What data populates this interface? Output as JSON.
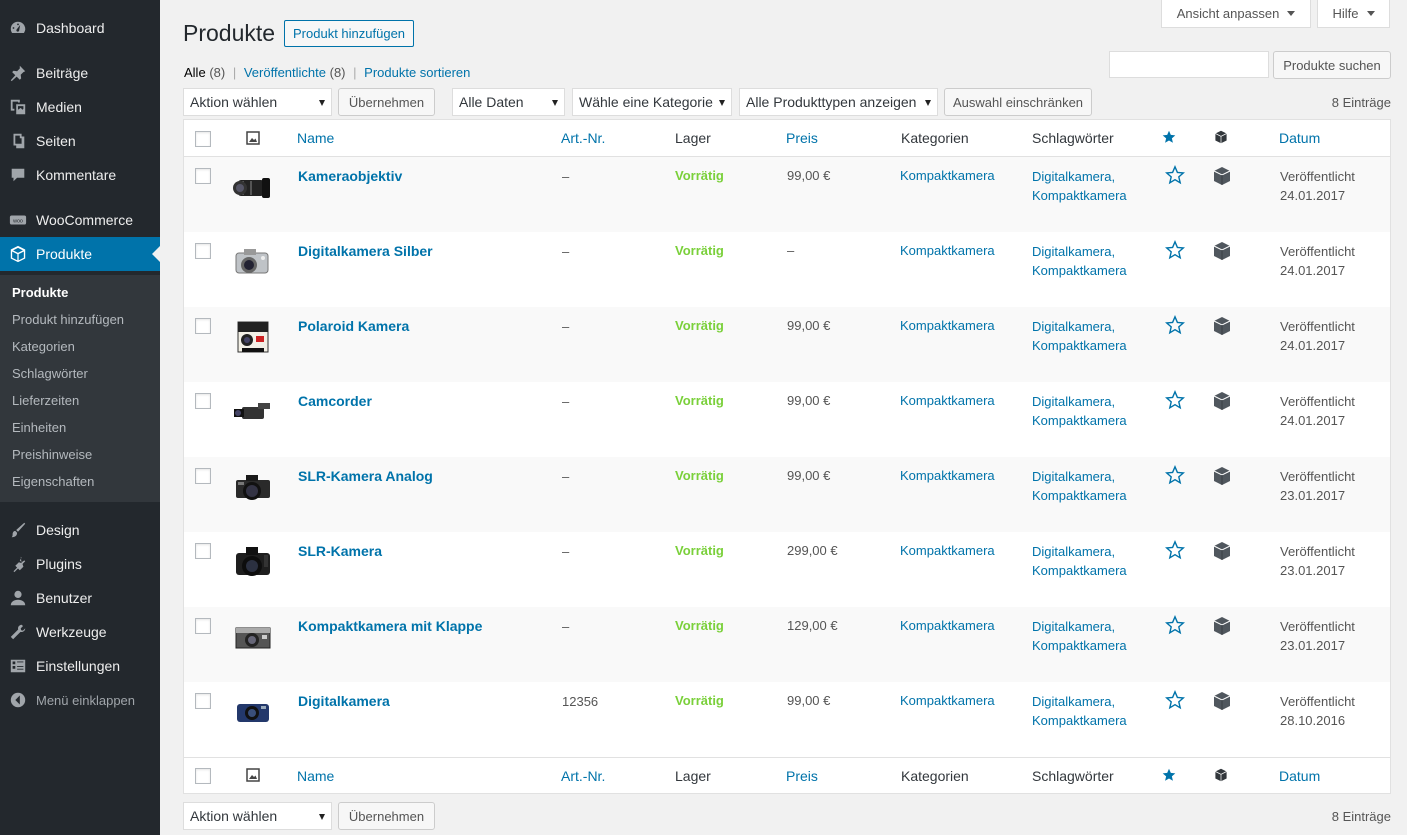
{
  "sidebar": {
    "items": [
      {
        "label": "Dashboard",
        "icon": "dashboard-icon"
      },
      {
        "label": "Beiträge",
        "icon": "pin-icon"
      },
      {
        "label": "Medien",
        "icon": "media-icon"
      },
      {
        "label": "Seiten",
        "icon": "pages-icon"
      },
      {
        "label": "Kommentare",
        "icon": "comments-icon"
      },
      {
        "label": "WooCommerce",
        "icon": "woocommerce-icon"
      },
      {
        "label": "Produkte",
        "icon": "box-icon"
      },
      {
        "label": "Design",
        "icon": "brush-icon"
      },
      {
        "label": "Plugins",
        "icon": "plugin-icon"
      },
      {
        "label": "Benutzer",
        "icon": "user-icon"
      },
      {
        "label": "Werkzeuge",
        "icon": "wrench-icon"
      },
      {
        "label": "Einstellungen",
        "icon": "settings-icon"
      },
      {
        "label": "Menü einklappen",
        "icon": "collapse-icon"
      }
    ],
    "submenu": [
      "Produkte",
      "Produkt hinzufügen",
      "Kategorien",
      "Schlagwörter",
      "Lieferzeiten",
      "Einheiten",
      "Preishinweise",
      "Eigenschaften"
    ]
  },
  "header": {
    "screen_options": "Ansicht anpassen",
    "help": "Hilfe",
    "title": "Produkte",
    "add_new": "Produkt hinzufügen"
  },
  "views": {
    "all": "Alle",
    "all_count": "(8)",
    "published": "Veröffentlichte",
    "published_count": "(8)",
    "sort": "Produkte sortieren",
    "separator": "|"
  },
  "search": {
    "button": "Produkte suchen",
    "value": ""
  },
  "filters": {
    "bulk_action": "Aktion wählen",
    "apply": "Übernehmen",
    "dates": "Alle Daten",
    "category": "Wähle eine Kategorie",
    "product_type": "Alle Produkttypen anzeigen",
    "filter_button": "Auswahl einschränken",
    "items_count": "8 Einträge"
  },
  "table": {
    "columns": {
      "name": "Name",
      "sku": "Art.-Nr.",
      "stock": "Lager",
      "price": "Preis",
      "categories": "Kategorien",
      "tags": "Schlagwörter",
      "date": "Datum"
    },
    "rows": [
      {
        "name": "Kameraobjektiv",
        "sku": "–",
        "stock": "Vorrätig",
        "price": "99,00 €",
        "category": "Kompaktkamera",
        "tag1": "Digitalkamera,",
        "tag2": "Kompaktkamera",
        "status": "Veröffentlicht",
        "date": "24.01.2017",
        "thumb": "lens"
      },
      {
        "name": "Digitalkamera Silber",
        "sku": "–",
        "stock": "Vorrätig",
        "price": "–",
        "category": "Kompaktkamera",
        "tag1": "Digitalkamera,",
        "tag2": "Kompaktkamera",
        "status": "Veröffentlicht",
        "date": "24.01.2017",
        "thumb": "silver-camera"
      },
      {
        "name": "Polaroid Kamera",
        "sku": "–",
        "stock": "Vorrätig",
        "price": "99,00 €",
        "category": "Kompaktkamera",
        "tag1": "Digitalkamera,",
        "tag2": "Kompaktkamera",
        "status": "Veröffentlicht",
        "date": "24.01.2017",
        "thumb": "polaroid"
      },
      {
        "name": "Camcorder",
        "sku": "–",
        "stock": "Vorrätig",
        "price": "99,00 €",
        "category": "Kompaktkamera",
        "tag1": "Digitalkamera,",
        "tag2": "Kompaktkamera",
        "status": "Veröffentlicht",
        "date": "24.01.2017",
        "thumb": "camcorder"
      },
      {
        "name": "SLR-Kamera Analog",
        "sku": "–",
        "stock": "Vorrätig",
        "price": "99,00 €",
        "category": "Kompaktkamera",
        "tag1": "Digitalkamera,",
        "tag2": "Kompaktkamera",
        "status": "Veröffentlicht",
        "date": "23.01.2017",
        "thumb": "slr-analog"
      },
      {
        "name": "SLR-Kamera",
        "sku": "–",
        "stock": "Vorrätig",
        "price": "299,00 €",
        "category": "Kompaktkamera",
        "tag1": "Digitalkamera,",
        "tag2": "Kompaktkamera",
        "status": "Veröffentlicht",
        "date": "23.01.2017",
        "thumb": "slr"
      },
      {
        "name": "Kompaktkamera mit Klappe",
        "sku": "–",
        "stock": "Vorrätig",
        "price": "129,00 €",
        "category": "Kompaktkamera",
        "tag1": "Digitalkamera,",
        "tag2": "Kompaktkamera",
        "status": "Veröffentlicht",
        "date": "23.01.2017",
        "thumb": "folding-camera"
      },
      {
        "name": "Digitalkamera",
        "sku": "12356",
        "stock": "Vorrätig",
        "price": "99,00 €",
        "category": "Kompaktkamera",
        "tag1": "Digitalkamera,",
        "tag2": "Kompaktkamera",
        "status": "Veröffentlicht",
        "date": "28.10.2016",
        "thumb": "blue-camera"
      }
    ]
  },
  "colors": {
    "sidebar_bg": "#23282d",
    "active": "#0073aa",
    "link": "#0073aa",
    "in_stock": "#7ad03a"
  }
}
